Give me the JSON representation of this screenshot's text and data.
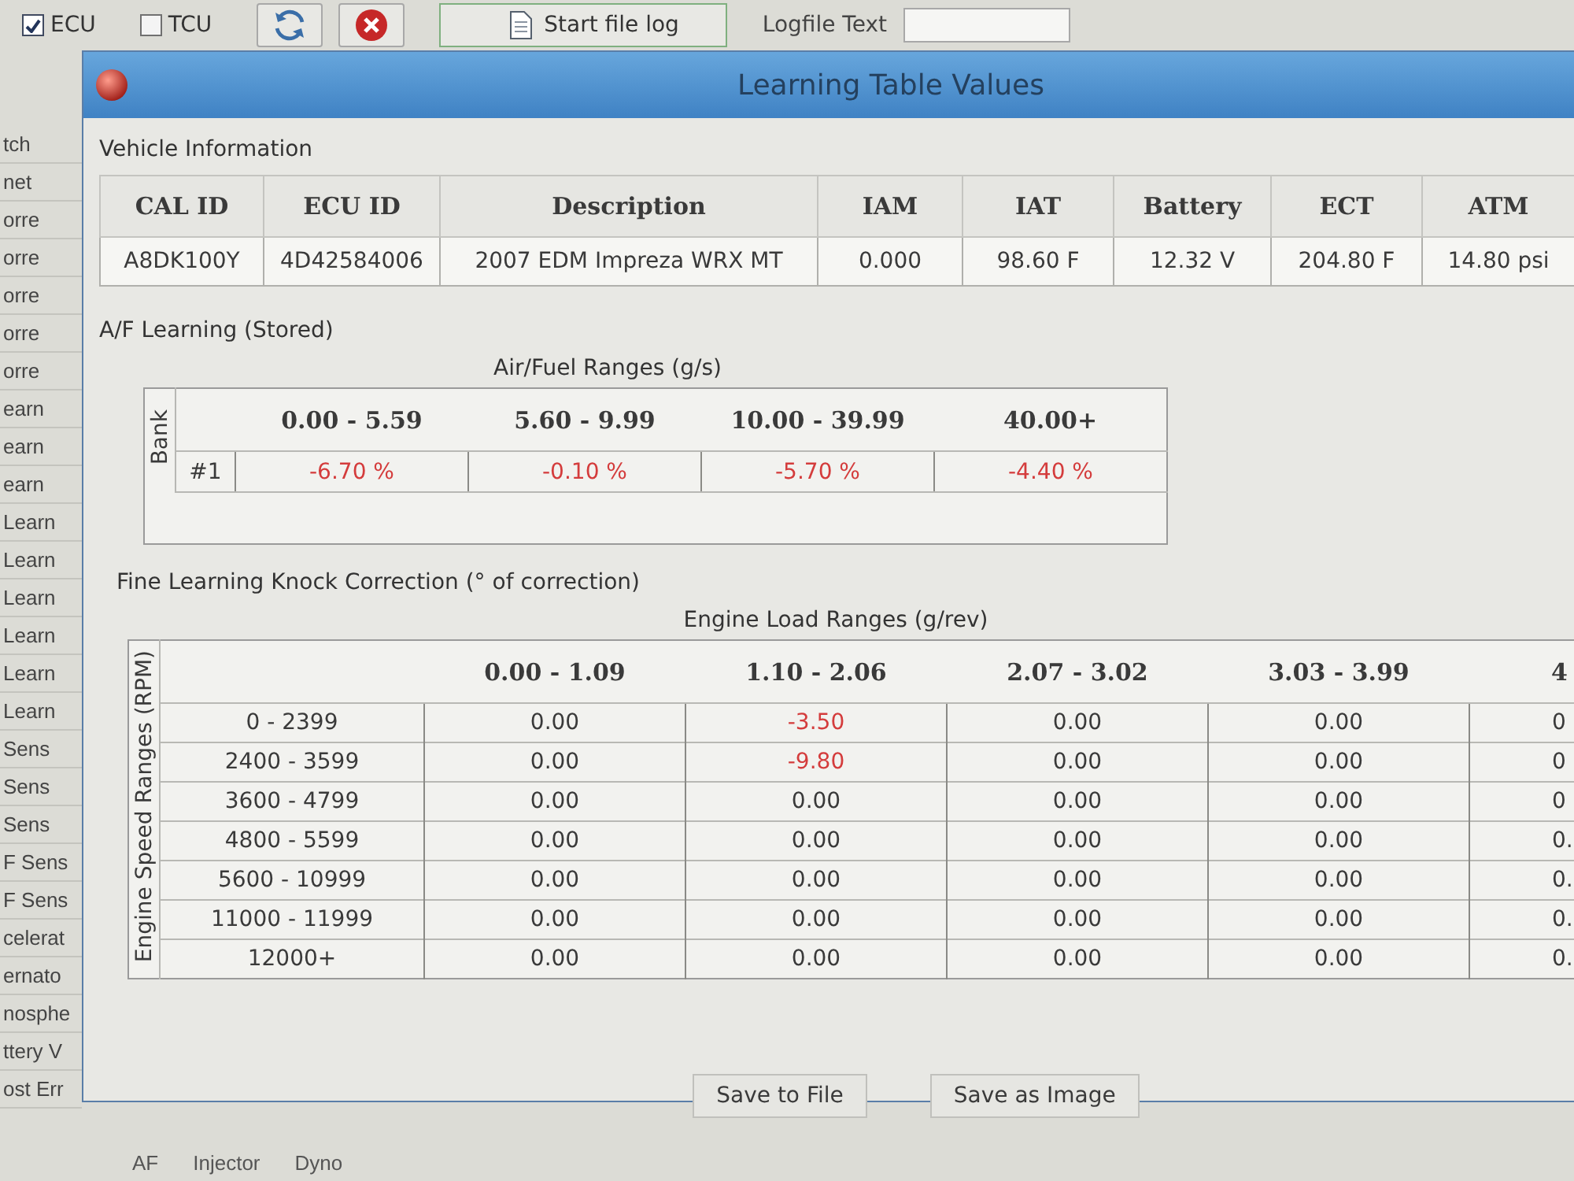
{
  "toolbar": {
    "checkboxes": [
      {
        "label": "ECU",
        "checked": true
      },
      {
        "label": "TCU",
        "checked": false
      }
    ],
    "log_button": "Start file log",
    "logfile_label": "Logfile Text"
  },
  "background_list": [
    "tch",
    "net",
    "orre",
    "orre",
    "orre",
    "orre",
    "orre",
    "earn",
    "earn",
    "earn",
    "Learn",
    "Learn",
    "Learn",
    "Learn",
    "Learn",
    "Learn",
    "Sens",
    "Sens",
    "Sens",
    "F Sens",
    "F Sens",
    "celerat",
    "ernato",
    "nosphe",
    "ttery V",
    "ost Err"
  ],
  "dialog": {
    "title": "Learning Table Values",
    "vehicle_information": {
      "title": "Vehicle Information",
      "columns": [
        "CAL ID",
        "ECU ID",
        "Description",
        "IAM",
        "IAT",
        "Battery",
        "ECT",
        "ATM"
      ],
      "rows": [
        [
          "A8DK100Y",
          "4D42584006",
          "2007 EDM Impreza WRX MT",
          "0.000",
          "98.60 F",
          "12.32 V",
          "204.80 F",
          "14.80 psi"
        ]
      ]
    },
    "af_learning": {
      "title": "A/F Learning (Stored)",
      "range_title": "Air/Fuel Ranges (g/s)",
      "row_axis": "Bank",
      "columns": [
        "0.00 - 5.59",
        "5.60 - 9.99",
        "10.00 - 39.99",
        "40.00+"
      ],
      "rows": [
        {
          "label": "#1",
          "cells": [
            {
              "value": "-6.70 %",
              "highlighted": true
            },
            {
              "value": "-0.10 %",
              "highlighted": true
            },
            {
              "value": "-5.70 %",
              "highlighted": true
            },
            {
              "value": "-4.40 %",
              "highlighted": true
            }
          ]
        }
      ]
    },
    "knock_correction": {
      "title": "Fine Learning Knock Correction (° of correction)",
      "range_title": "Engine Load Ranges (g/rev)",
      "row_axis": "Engine Speed Ranges (RPM)",
      "columns": [
        "0.00 - 1.09",
        "1.10 - 2.06",
        "2.07 - 3.02",
        "3.03 - 3.99",
        "4"
      ],
      "rows": [
        {
          "label": "0 - 2399",
          "cells": [
            {
              "value": "0.00",
              "highlighted": false
            },
            {
              "value": "-3.50",
              "highlighted": true
            },
            {
              "value": "0.00",
              "highlighted": false
            },
            {
              "value": "0.00",
              "highlighted": false
            },
            {
              "value": "0",
              "highlighted": false
            }
          ]
        },
        {
          "label": "2400 - 3599",
          "cells": [
            {
              "value": "0.00",
              "highlighted": false
            },
            {
              "value": "-9.80",
              "highlighted": true
            },
            {
              "value": "0.00",
              "highlighted": false
            },
            {
              "value": "0.00",
              "highlighted": false
            },
            {
              "value": "0",
              "highlighted": false
            }
          ]
        },
        {
          "label": "3600 - 4799",
          "cells": [
            {
              "value": "0.00",
              "highlighted": false
            },
            {
              "value": "0.00",
              "highlighted": false
            },
            {
              "value": "0.00",
              "highlighted": false
            },
            {
              "value": "0.00",
              "highlighted": false
            },
            {
              "value": "0",
              "highlighted": false
            }
          ]
        },
        {
          "label": "4800 - 5599",
          "cells": [
            {
              "value": "0.00",
              "highlighted": false
            },
            {
              "value": "0.00",
              "highlighted": false
            },
            {
              "value": "0.00",
              "highlighted": false
            },
            {
              "value": "0.00",
              "highlighted": false
            },
            {
              "value": "0.",
              "highlighted": false
            }
          ]
        },
        {
          "label": "5600 - 10999",
          "cells": [
            {
              "value": "0.00",
              "highlighted": false
            },
            {
              "value": "0.00",
              "highlighted": false
            },
            {
              "value": "0.00",
              "highlighted": false
            },
            {
              "value": "0.00",
              "highlighted": false
            },
            {
              "value": "0.",
              "highlighted": false
            }
          ]
        },
        {
          "label": "11000 - 11999",
          "cells": [
            {
              "value": "0.00",
              "highlighted": false
            },
            {
              "value": "0.00",
              "highlighted": false
            },
            {
              "value": "0.00",
              "highlighted": false
            },
            {
              "value": "0.00",
              "highlighted": false
            },
            {
              "value": "0.",
              "highlighted": false
            }
          ]
        },
        {
          "label": "12000+",
          "cells": [
            {
              "value": "0.00",
              "highlighted": false
            },
            {
              "value": "0.00",
              "highlighted": false
            },
            {
              "value": "0.00",
              "highlighted": false
            },
            {
              "value": "0.00",
              "highlighted": false
            },
            {
              "value": "0.",
              "highlighted": false
            }
          ]
        }
      ]
    },
    "buttons": [
      "Save to File",
      "Save as Image"
    ]
  },
  "bottom_tabs": [
    {
      "label": "AF",
      "selected": false
    },
    {
      "label": "Injector",
      "selected": false
    },
    {
      "label": "Dyno",
      "selected": false
    }
  ]
}
